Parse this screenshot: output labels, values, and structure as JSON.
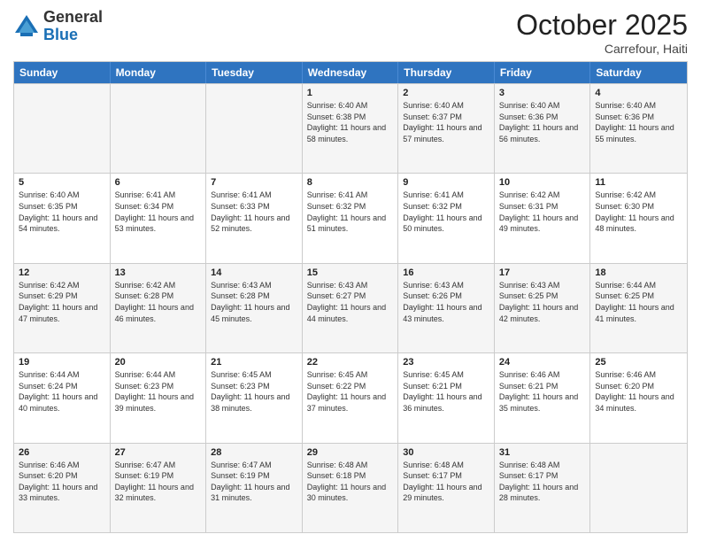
{
  "header": {
    "logo_general": "General",
    "logo_blue": "Blue",
    "month_title": "October 2025",
    "subtitle": "Carrefour, Haiti"
  },
  "weekdays": [
    "Sunday",
    "Monday",
    "Tuesday",
    "Wednesday",
    "Thursday",
    "Friday",
    "Saturday"
  ],
  "rows": [
    [
      {
        "day": "",
        "sunrise": "",
        "sunset": "",
        "daylight": ""
      },
      {
        "day": "",
        "sunrise": "",
        "sunset": "",
        "daylight": ""
      },
      {
        "day": "",
        "sunrise": "",
        "sunset": "",
        "daylight": ""
      },
      {
        "day": "1",
        "sunrise": "Sunrise: 6:40 AM",
        "sunset": "Sunset: 6:38 PM",
        "daylight": "Daylight: 11 hours and 58 minutes."
      },
      {
        "day": "2",
        "sunrise": "Sunrise: 6:40 AM",
        "sunset": "Sunset: 6:37 PM",
        "daylight": "Daylight: 11 hours and 57 minutes."
      },
      {
        "day": "3",
        "sunrise": "Sunrise: 6:40 AM",
        "sunset": "Sunset: 6:36 PM",
        "daylight": "Daylight: 11 hours and 56 minutes."
      },
      {
        "day": "4",
        "sunrise": "Sunrise: 6:40 AM",
        "sunset": "Sunset: 6:36 PM",
        "daylight": "Daylight: 11 hours and 55 minutes."
      }
    ],
    [
      {
        "day": "5",
        "sunrise": "Sunrise: 6:40 AM",
        "sunset": "Sunset: 6:35 PM",
        "daylight": "Daylight: 11 hours and 54 minutes."
      },
      {
        "day": "6",
        "sunrise": "Sunrise: 6:41 AM",
        "sunset": "Sunset: 6:34 PM",
        "daylight": "Daylight: 11 hours and 53 minutes."
      },
      {
        "day": "7",
        "sunrise": "Sunrise: 6:41 AM",
        "sunset": "Sunset: 6:33 PM",
        "daylight": "Daylight: 11 hours and 52 minutes."
      },
      {
        "day": "8",
        "sunrise": "Sunrise: 6:41 AM",
        "sunset": "Sunset: 6:32 PM",
        "daylight": "Daylight: 11 hours and 51 minutes."
      },
      {
        "day": "9",
        "sunrise": "Sunrise: 6:41 AM",
        "sunset": "Sunset: 6:32 PM",
        "daylight": "Daylight: 11 hours and 50 minutes."
      },
      {
        "day": "10",
        "sunrise": "Sunrise: 6:42 AM",
        "sunset": "Sunset: 6:31 PM",
        "daylight": "Daylight: 11 hours and 49 minutes."
      },
      {
        "day": "11",
        "sunrise": "Sunrise: 6:42 AM",
        "sunset": "Sunset: 6:30 PM",
        "daylight": "Daylight: 11 hours and 48 minutes."
      }
    ],
    [
      {
        "day": "12",
        "sunrise": "Sunrise: 6:42 AM",
        "sunset": "Sunset: 6:29 PM",
        "daylight": "Daylight: 11 hours and 47 minutes."
      },
      {
        "day": "13",
        "sunrise": "Sunrise: 6:42 AM",
        "sunset": "Sunset: 6:28 PM",
        "daylight": "Daylight: 11 hours and 46 minutes."
      },
      {
        "day": "14",
        "sunrise": "Sunrise: 6:43 AM",
        "sunset": "Sunset: 6:28 PM",
        "daylight": "Daylight: 11 hours and 45 minutes."
      },
      {
        "day": "15",
        "sunrise": "Sunrise: 6:43 AM",
        "sunset": "Sunset: 6:27 PM",
        "daylight": "Daylight: 11 hours and 44 minutes."
      },
      {
        "day": "16",
        "sunrise": "Sunrise: 6:43 AM",
        "sunset": "Sunset: 6:26 PM",
        "daylight": "Daylight: 11 hours and 43 minutes."
      },
      {
        "day": "17",
        "sunrise": "Sunrise: 6:43 AM",
        "sunset": "Sunset: 6:25 PM",
        "daylight": "Daylight: 11 hours and 42 minutes."
      },
      {
        "day": "18",
        "sunrise": "Sunrise: 6:44 AM",
        "sunset": "Sunset: 6:25 PM",
        "daylight": "Daylight: 11 hours and 41 minutes."
      }
    ],
    [
      {
        "day": "19",
        "sunrise": "Sunrise: 6:44 AM",
        "sunset": "Sunset: 6:24 PM",
        "daylight": "Daylight: 11 hours and 40 minutes."
      },
      {
        "day": "20",
        "sunrise": "Sunrise: 6:44 AM",
        "sunset": "Sunset: 6:23 PM",
        "daylight": "Daylight: 11 hours and 39 minutes."
      },
      {
        "day": "21",
        "sunrise": "Sunrise: 6:45 AM",
        "sunset": "Sunset: 6:23 PM",
        "daylight": "Daylight: 11 hours and 38 minutes."
      },
      {
        "day": "22",
        "sunrise": "Sunrise: 6:45 AM",
        "sunset": "Sunset: 6:22 PM",
        "daylight": "Daylight: 11 hours and 37 minutes."
      },
      {
        "day": "23",
        "sunrise": "Sunrise: 6:45 AM",
        "sunset": "Sunset: 6:21 PM",
        "daylight": "Daylight: 11 hours and 36 minutes."
      },
      {
        "day": "24",
        "sunrise": "Sunrise: 6:46 AM",
        "sunset": "Sunset: 6:21 PM",
        "daylight": "Daylight: 11 hours and 35 minutes."
      },
      {
        "day": "25",
        "sunrise": "Sunrise: 6:46 AM",
        "sunset": "Sunset: 6:20 PM",
        "daylight": "Daylight: 11 hours and 34 minutes."
      }
    ],
    [
      {
        "day": "26",
        "sunrise": "Sunrise: 6:46 AM",
        "sunset": "Sunset: 6:20 PM",
        "daylight": "Daylight: 11 hours and 33 minutes."
      },
      {
        "day": "27",
        "sunrise": "Sunrise: 6:47 AM",
        "sunset": "Sunset: 6:19 PM",
        "daylight": "Daylight: 11 hours and 32 minutes."
      },
      {
        "day": "28",
        "sunrise": "Sunrise: 6:47 AM",
        "sunset": "Sunset: 6:19 PM",
        "daylight": "Daylight: 11 hours and 31 minutes."
      },
      {
        "day": "29",
        "sunrise": "Sunrise: 6:48 AM",
        "sunset": "Sunset: 6:18 PM",
        "daylight": "Daylight: 11 hours and 30 minutes."
      },
      {
        "day": "30",
        "sunrise": "Sunrise: 6:48 AM",
        "sunset": "Sunset: 6:17 PM",
        "daylight": "Daylight: 11 hours and 29 minutes."
      },
      {
        "day": "31",
        "sunrise": "Sunrise: 6:48 AM",
        "sunset": "Sunset: 6:17 PM",
        "daylight": "Daylight: 11 hours and 28 minutes."
      },
      {
        "day": "",
        "sunrise": "",
        "sunset": "",
        "daylight": ""
      }
    ]
  ],
  "alt_rows": [
    0,
    2,
    4
  ]
}
